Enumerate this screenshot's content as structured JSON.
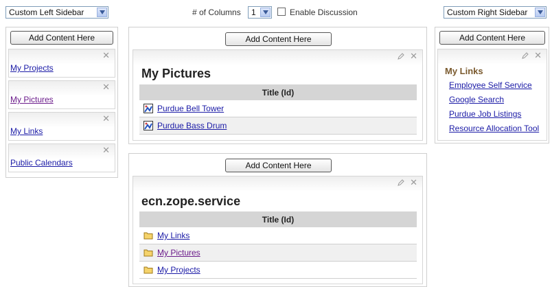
{
  "top": {
    "left_sidebar": "Custom Left Sidebar",
    "columns_label": "# of Columns",
    "columns_value": "1",
    "enable_discussion": "Enable Discussion",
    "right_sidebar": "Custom Right Sidebar"
  },
  "add_content": "Add Content Here",
  "left": {
    "items": [
      {
        "label": "My Projects"
      },
      {
        "label": "My Pictures"
      },
      {
        "label": "My Links"
      },
      {
        "label": "Public Calendars"
      }
    ]
  },
  "center": {
    "pictures": {
      "title": "My Pictures",
      "col_header": "Title (Id)",
      "rows": [
        {
          "label": "Purdue Bell Tower"
        },
        {
          "label": "Purdue Bass Drum"
        }
      ]
    },
    "service": {
      "title": "ecn.zope.service",
      "col_header": "Title (Id)",
      "rows": [
        {
          "label": "My Links"
        },
        {
          "label": "My Pictures"
        },
        {
          "label": "My Projects"
        }
      ]
    }
  },
  "right": {
    "title": "My Links",
    "links": [
      {
        "label": "Employee Self Service"
      },
      {
        "label": "Google Search"
      },
      {
        "label": "Purdue Job Listings"
      },
      {
        "label": "Resource Allocation Tool"
      }
    ]
  },
  "icons": {
    "close": "close-icon",
    "edit": "pencil-icon",
    "image": "image-icon",
    "folder": "folder-icon",
    "dropdown": "chevron-down-icon"
  },
  "colors": {
    "link": "#1a1aa6",
    "visited": "#6a1a8a",
    "header_bg": "#d5d5d5",
    "portlet_title": "#7a5a2e"
  }
}
